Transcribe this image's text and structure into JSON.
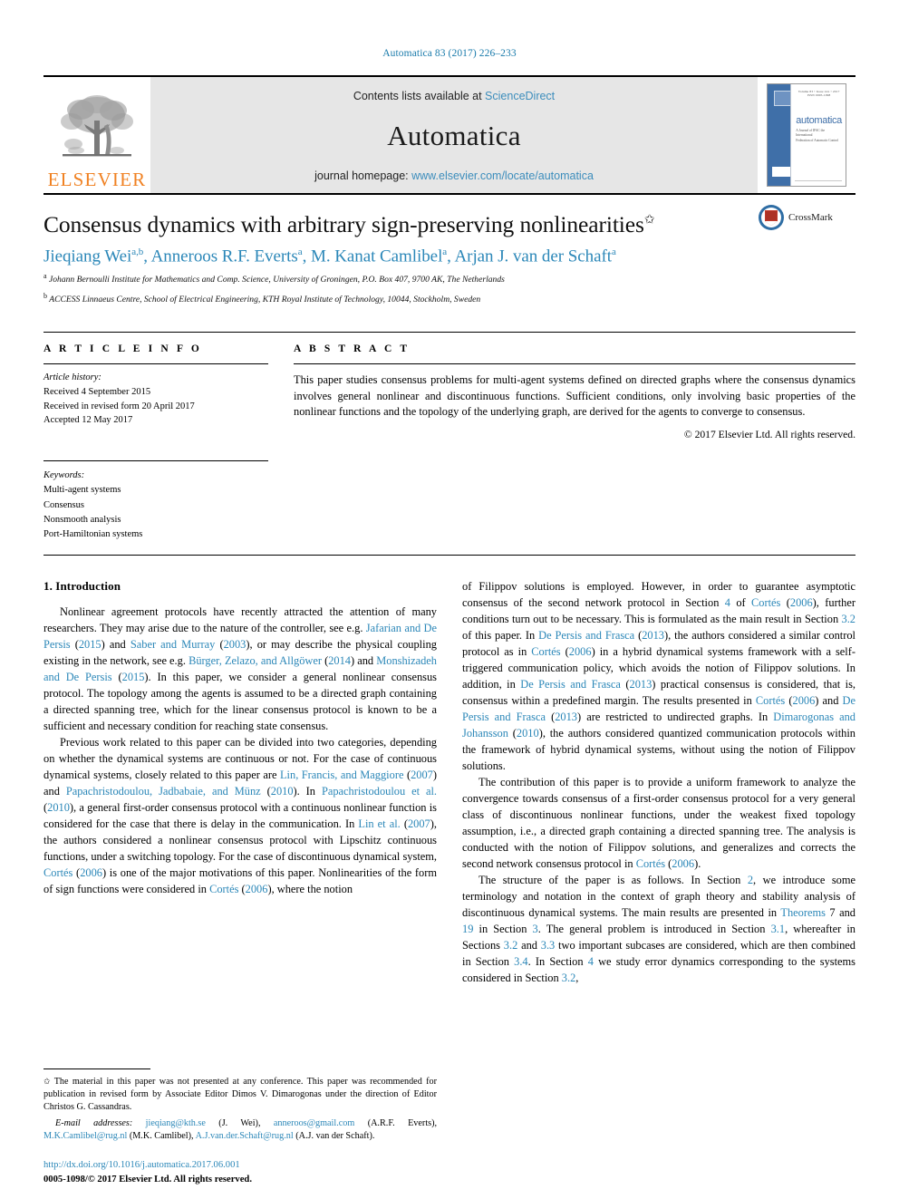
{
  "running_head": "Automatica 83 (2017) 226–233",
  "masthead": {
    "publisher_wordmark": "ELSEVIER",
    "contents_prefix": "Contents lists available at ",
    "contents_link": "ScienceDirect",
    "journal_name": "Automatica",
    "homepage_prefix": "journal homepage: ",
    "homepage_url": "www.elsevier.com/locate/automatica",
    "cover": {
      "top_rule_text": "Volume 83  •  Issue xxx  •  2017          ISSN 0005-1098",
      "title": "automatica",
      "subtitle_line1": "A Journal of IFAC the International",
      "subtitle_line2": "Federation of Automatic Control",
      "badge": "IFAC"
    }
  },
  "article": {
    "title": "Consensus dynamics with arbitrary sign-preserving nonlinearities",
    "title_star": "✩",
    "authors_html": "Jieqiang Wei<sup>a,b</sup>, Anneroos R.F. Everts<sup>a</sup>, M. Kanat Camlibel<sup>a</sup>, Arjan J. van der Schaft<sup>a</sup>",
    "affiliations": [
      "Johann Bernoulli Institute for Mathematics and Comp. Science, University of Groningen, P.O. Box 407, 9700 AK, The Netherlands",
      "ACCESS Linnaeus Centre, School of Electrical Engineering, KTH Royal Institute of Technology, 10044, Stockholm, Sweden"
    ],
    "affiliation_marks": [
      "a",
      "b"
    ],
    "crossmark_label": "CrossMark"
  },
  "article_info": {
    "heading": "A R T I C L E   I N F O",
    "history_heading": "Article history:",
    "history": [
      "Received 4 September 2015",
      "Received in revised form 20 April 2017",
      "Accepted 12 May 2017"
    ],
    "keywords_heading": "Keywords:",
    "keywords": [
      "Multi-agent systems",
      "Consensus",
      "Nonsmooth analysis",
      "Port-Hamiltonian systems"
    ]
  },
  "abstract": {
    "heading": "A B S T R A C T",
    "text": "This paper studies consensus problems for multi-agent systems defined on directed graphs where the consensus dynamics involves general nonlinear and discontinuous functions. Sufficient conditions, only involving basic properties of the nonlinear functions and the topology of the underlying graph, are derived for the agents to converge to consensus.",
    "copyright": "© 2017 Elsevier Ltd. All rights reserved."
  },
  "body": {
    "section_1_title": "1. Introduction",
    "left_para_1": "Nonlinear agreement protocols have recently attracted the attention of many researchers. They may arise due to the nature of the controller, see e.g. Jafarian and De Persis (2015) and Saber and Murray (2003), or may describe the physical coupling existing in the network, see e.g. Bürger, Zelazo, and Allgöwer (2014) and Monshizadeh and De Persis (2015). In this paper, we consider a general nonlinear consensus protocol. The topology among the agents is assumed to be a directed graph containing a directed spanning tree, which for the linear consensus protocol is known to be a sufficient and necessary condition for reaching state consensus.",
    "left_para_2": "Previous work related to this paper can be divided into two categories, depending on whether the dynamical systems are continuous or not. For the case of continuous dynamical systems, closely related to this paper are Lin, Francis, and Maggiore (2007) and Papachristodoulou, Jadbabaie, and Münz (2010). In Papachristodoulou et al. (2010), a general first-order consensus protocol with a continuous nonlinear function is considered for the case that there is delay in the communication. In Lin et al. (2007), the authors considered a nonlinear consensus protocol with Lipschitz continuous functions, under a switching topology. For the case of discontinuous dynamical system, Cortés (2006) is one of the major motivations of this paper. Nonlinearities of the form of sign functions were considered in Cortés (2006), where the notion",
    "right_para_1": "of Filippov solutions is employed. However, in order to guarantee asymptotic consensus of the second network protocol in Section 4 of Cortés (2006), further conditions turn out to be necessary. This is formulated as the main result in Section 3.2 of this paper. In De Persis and Frasca (2013), the authors considered a similar control protocol as in Cortés (2006) in a hybrid dynamical systems framework with a self-triggered communication policy, which avoids the notion of Filippov solutions. In addition, in De Persis and Frasca (2013) practical consensus is considered, that is, consensus within a predefined margin. The results presented in Cortés (2006) and De Persis and Frasca (2013) are restricted to undirected graphs. In Dimarogonas and Johansson (2010), the authors considered quantized communication protocols within the framework of hybrid dynamical systems, without using the notion of Filippov solutions.",
    "right_para_2": "The contribution of this paper is to provide a uniform framework to analyze the convergence towards consensus of a first-order consensus protocol for a very general class of discontinuous nonlinear functions, under the weakest fixed topology assumption, i.e., a directed graph containing a directed spanning tree. The analysis is conducted with the notion of Filippov solutions, and generalizes and corrects the second network consensus protocol in Cortés (2006).",
    "right_para_3": "The structure of the paper is as follows. In Section 2, we introduce some terminology and notation in the context of graph theory and stability analysis of discontinuous dynamical systems. The main results are presented in Theorems 7 and 19 in Section 3. The general problem is introduced in Section 3.1, whereafter in Sections 3.2 and 3.3 two important subcases are considered, which are then combined in Section 3.4. In Section 4 we study error dynamics corresponding to the systems considered in Section 3.2,"
  },
  "footnotes": {
    "star_marker": "✩",
    "note_text": "The material in this paper was not presented at any conference. This paper was recommended for publication in revised form by Associate Editor Dimos V. Dimarogonas under the direction of Editor Christos G. Cassandras.",
    "emails_label": "E-mail addresses:",
    "emails": [
      {
        "address": "jieqiang@kth.se",
        "owner": "(J. Wei)"
      },
      {
        "address": "anneroos@gmail.com",
        "owner": "(A.R.F. Everts)"
      },
      {
        "address": "M.K.Camlibel@rug.nl",
        "owner": "(M.K. Camlibel)"
      },
      {
        "address": "A.J.van.der.Schaft@rug.nl",
        "owner": "(A.J. van der Schaft)"
      }
    ],
    "doi_url": "http://dx.doi.org/10.1016/j.automatica.2017.06.001",
    "issn_line": "0005-1098/© 2017 Elsevier Ltd. All rights reserved."
  },
  "colors": {
    "link_blue": "#2b87b8",
    "header_blue": "#1a7bab",
    "elsevier_orange": "#F08122",
    "masthead_gray": "#e6e6e6"
  }
}
